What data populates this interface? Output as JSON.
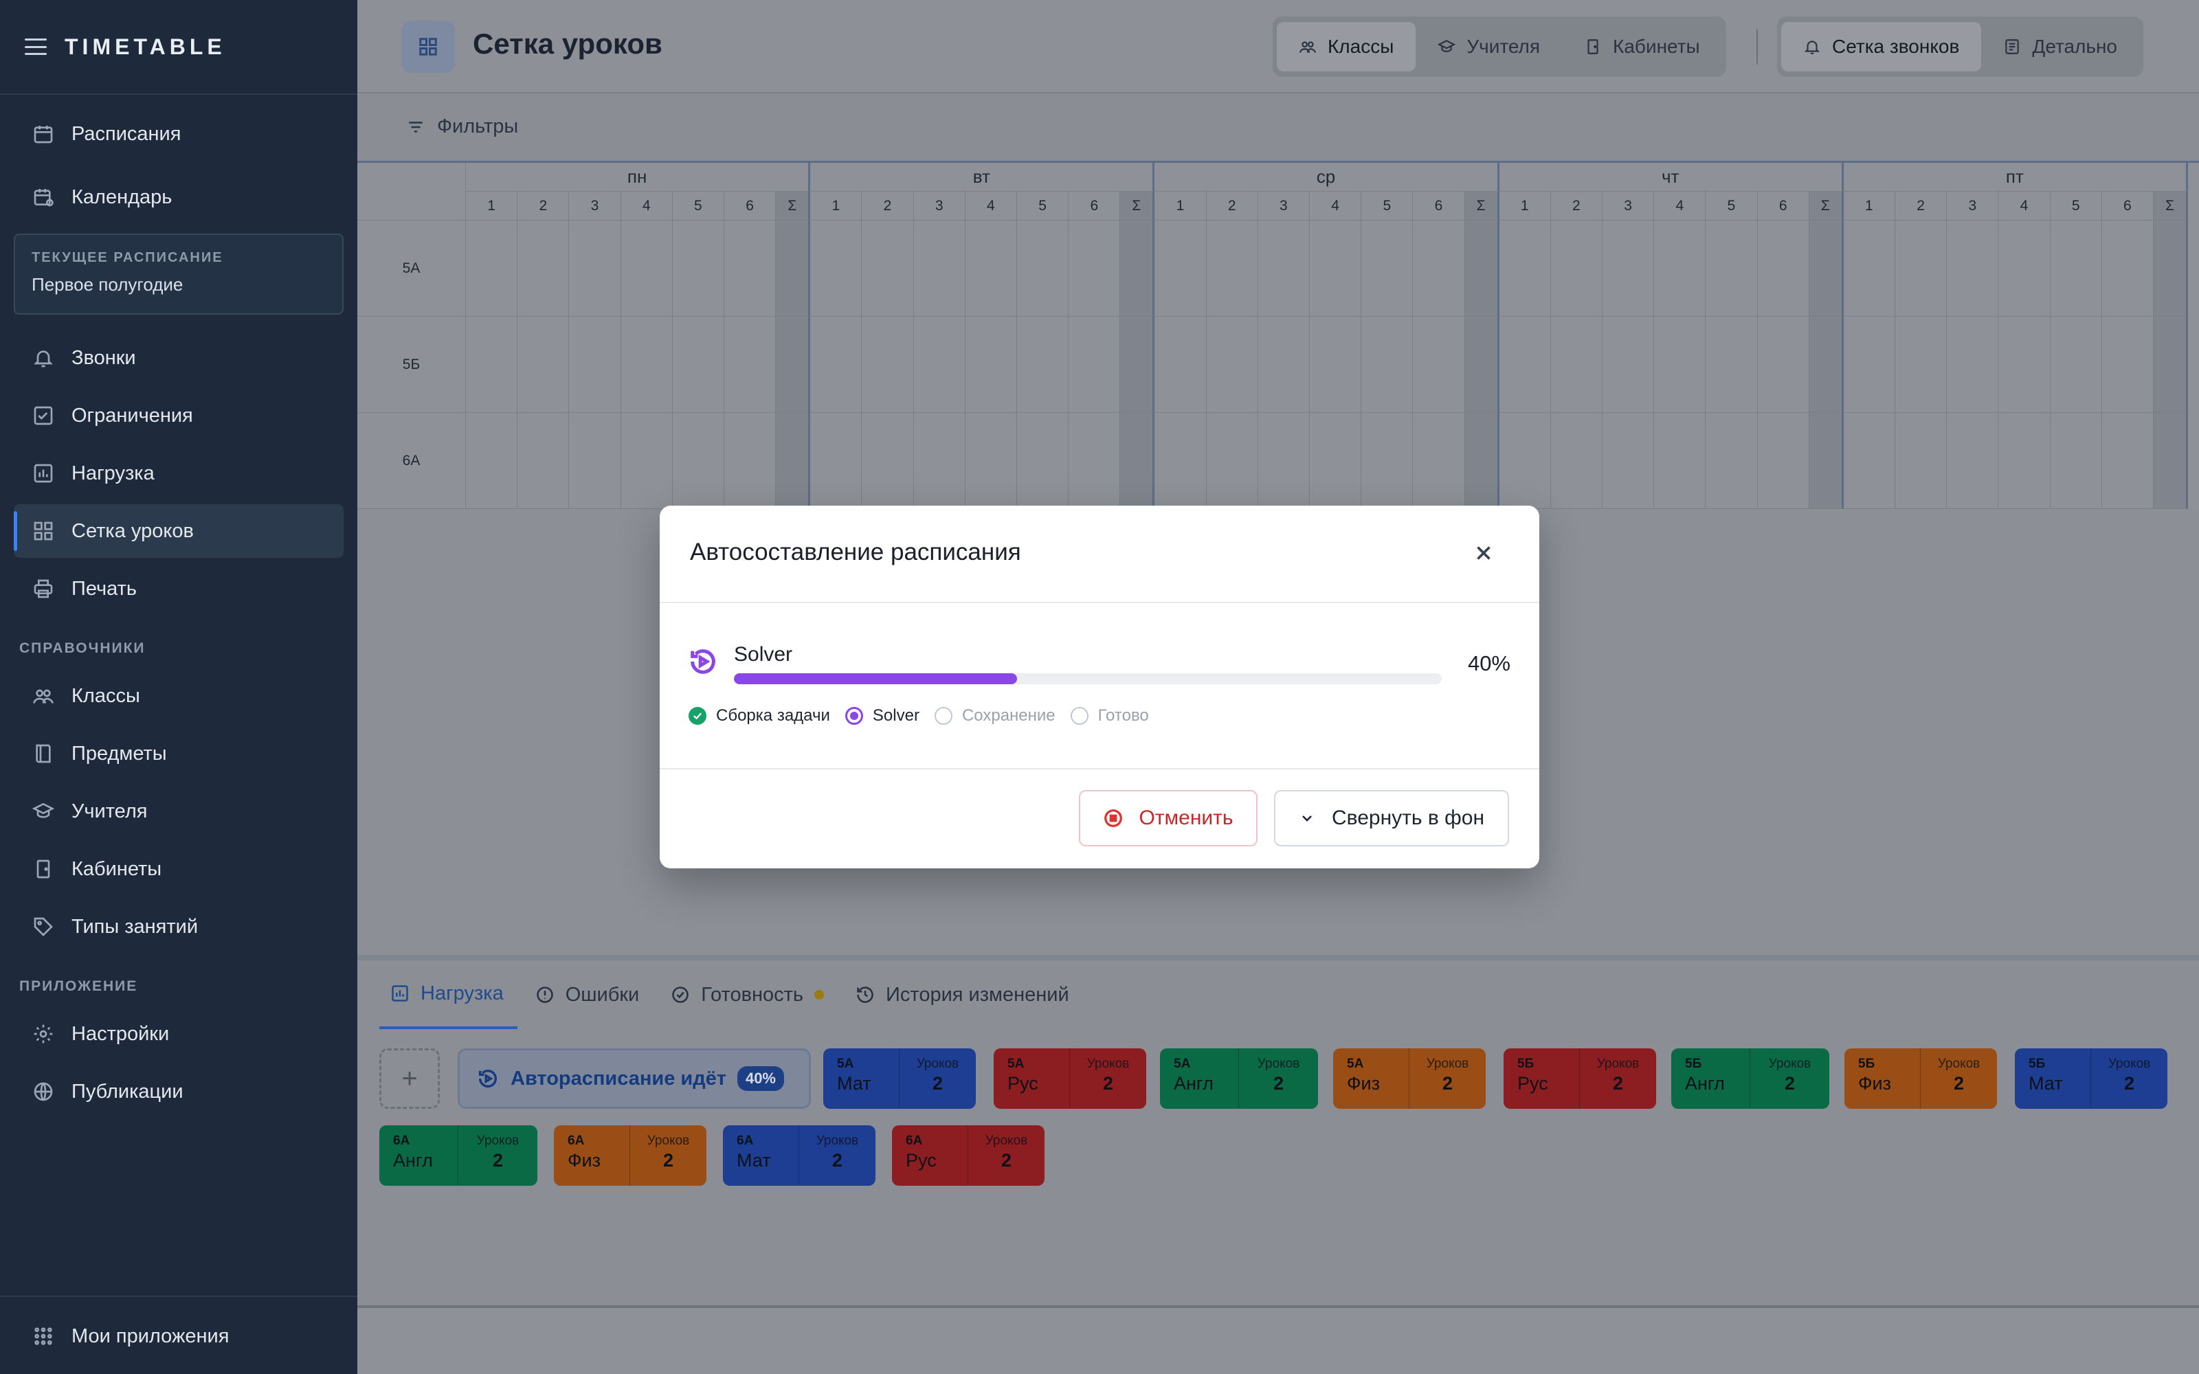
{
  "app": {
    "logo": "TIMETABLE"
  },
  "sidebar": {
    "top_items": [
      {
        "label": "Расписания",
        "icon": "calendar-icon"
      },
      {
        "label": "Календарь",
        "icon": "calendar-clock-icon"
      }
    ],
    "current": {
      "caption": "ТЕКУЩЕЕ РАСПИСАНИЕ",
      "value": "Первое полугодие"
    },
    "main_items": [
      {
        "label": "Звонки",
        "icon": "bell-icon"
      },
      {
        "label": "Ограничения",
        "icon": "checklist-icon"
      },
      {
        "label": "Нагрузка",
        "icon": "bar-chart-icon"
      },
      {
        "label": "Сетка уроков",
        "icon": "grid-icon",
        "active": true
      },
      {
        "label": "Печать",
        "icon": "printer-icon"
      }
    ],
    "section_refs": "СПРАВОЧНИКИ",
    "ref_items": [
      {
        "label": "Классы",
        "icon": "people-icon"
      },
      {
        "label": "Предметы",
        "icon": "book-icon"
      },
      {
        "label": "Учителя",
        "icon": "graduation-cap-icon"
      },
      {
        "label": "Кабинеты",
        "icon": "door-icon"
      },
      {
        "label": "Типы занятий",
        "icon": "tag-icon"
      }
    ],
    "section_app": "ПРИЛОЖЕНИЕ",
    "app_items": [
      {
        "label": "Настройки",
        "icon": "gear-icon"
      },
      {
        "label": "Публикации",
        "icon": "globe-icon"
      }
    ],
    "footer": {
      "label": "Мои приложения",
      "icon": "apps-grid-icon"
    }
  },
  "header": {
    "title": "Сетка уроков",
    "view_tabs": [
      {
        "label": "Классы",
        "icon": "people-icon",
        "active": true
      },
      {
        "label": "Учителя",
        "icon": "graduation-cap-icon"
      },
      {
        "label": "Кабинеты",
        "icon": "door-icon"
      }
    ],
    "mode_tabs": [
      {
        "label": "Сетка звонков",
        "icon": "bell-icon",
        "active": true
      },
      {
        "label": "Детально",
        "icon": "list-icon"
      }
    ]
  },
  "filters": {
    "label": "Фильтры"
  },
  "grid": {
    "days": [
      "пн",
      "вт",
      "ср",
      "чт",
      "пт"
    ],
    "periods": [
      "1",
      "2",
      "3",
      "4",
      "5",
      "6",
      "Σ"
    ],
    "rows": [
      "5А",
      "5Б",
      "6А"
    ]
  },
  "bottom": {
    "tabs": [
      {
        "label": "Нагрузка",
        "icon": "bar-chart-icon",
        "active": true
      },
      {
        "label": "Ошибки",
        "icon": "alert-circle-icon"
      },
      {
        "label": "Готовность",
        "icon": "badge-check-icon",
        "dot": true
      },
      {
        "label": "История изменений",
        "icon": "history-icon"
      }
    ],
    "auto_chip": {
      "label": "Авторасписание идёт",
      "percent": "40%"
    },
    "load_caption": "Уроков",
    "cards": [
      {
        "cls": "5А",
        "subject": "Мат",
        "count": "2",
        "color": "#1d3e93"
      },
      {
        "cls": "5А",
        "subject": "Рус",
        "count": "2",
        "color": "#8c1e22"
      },
      {
        "cls": "5А",
        "subject": "Англ",
        "count": "2",
        "color": "#0b6a46"
      },
      {
        "cls": "5А",
        "subject": "Физ",
        "count": "2",
        "color": "#9a4e15"
      },
      {
        "cls": "5Б",
        "subject": "Рус",
        "count": "2",
        "color": "#8c1e22"
      },
      {
        "cls": "5Б",
        "subject": "Англ",
        "count": "2",
        "color": "#0b6a46"
      },
      {
        "cls": "5Б",
        "subject": "Физ",
        "count": "2",
        "color": "#9a4e15"
      },
      {
        "cls": "5Б",
        "subject": "Мат",
        "count": "2",
        "color": "#1d3e93"
      },
      {
        "cls": "6А",
        "subject": "Англ",
        "count": "2",
        "color": "#0b6a46"
      },
      {
        "cls": "6А",
        "subject": "Физ",
        "count": "2",
        "color": "#9a4e15"
      },
      {
        "cls": "6А",
        "subject": "Мат",
        "count": "2",
        "color": "#1d3e93"
      },
      {
        "cls": "6А",
        "subject": "Рус",
        "count": "2",
        "color": "#8c1e22"
      }
    ]
  },
  "modal": {
    "title": "Автосоставление расписания",
    "stage": "Solver",
    "progress": 0.4,
    "progress_label": "40%",
    "steps": [
      {
        "label": "Сборка задачи",
        "state": "done"
      },
      {
        "label": "Solver",
        "state": "current"
      },
      {
        "label": "Сохранение",
        "state": "todo"
      },
      {
        "label": "Готово",
        "state": "todo"
      }
    ],
    "cancel_label": "Отменить",
    "background_label": "Свернуть в фон",
    "accent": "#8b46e6"
  }
}
